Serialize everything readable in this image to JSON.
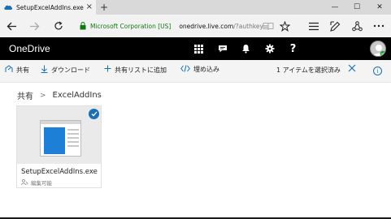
{
  "browser": {
    "tab_title": "SetupExcelAddIns.exe",
    "tab_close": "×",
    "new_tab": "+",
    "window": {
      "minimize": "—",
      "maximize": "☐",
      "close": "✕"
    },
    "cert": "Microsoft Corporation [US]",
    "url_host": "onedrive.live.com",
    "url_path": "/?authkey=",
    "icons": [
      "back-arrow-icon",
      "forward-arrow-icon",
      "refresh-icon",
      "lock-icon",
      "reading-view-icon",
      "favorite-star-icon",
      "hub-icon",
      "web-note-icon",
      "share-icon",
      "more-icon"
    ]
  },
  "header": {
    "brand": "OneDrive",
    "icons": [
      "app-launcher-icon",
      "chat-icon",
      "notifications-bell-icon",
      "settings-gear-icon",
      "help-icon"
    ],
    "help_label": "?"
  },
  "commands": {
    "share": "共有",
    "download": "ダウンロード",
    "add_to_shared": "共有リストに追加",
    "embed": "埋め込み",
    "selection": "1 アイテムを選択済み",
    "info": "i"
  },
  "breadcrumb": {
    "root": "共有",
    "separator": ">",
    "current": "ExcelAddIns"
  },
  "file": {
    "name": "SetupExcelAddIns.exe",
    "permission": "編集可能"
  },
  "colors": {
    "accent": "#1a6fb5",
    "header_bg": "#000000",
    "cert_green": "#0f7b0f"
  }
}
